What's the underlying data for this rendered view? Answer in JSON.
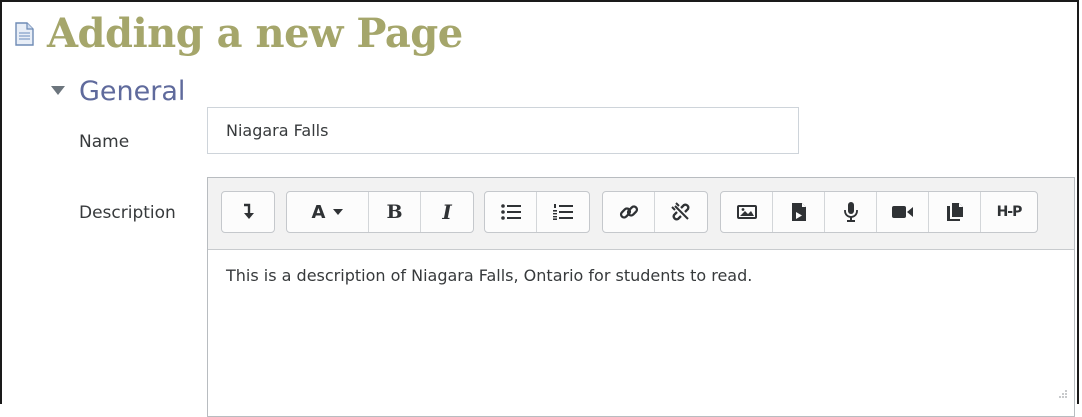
{
  "page": {
    "title": "Adding a new Page",
    "title_color": "#a5a66b"
  },
  "section": {
    "title": "General",
    "title_color": "#5f6a9c"
  },
  "fields": {
    "name_label": "Name",
    "name_value": "Niagara Falls",
    "description_label": "Description",
    "description_text": "This is a description of Niagara Falls, Ontario for students to read."
  },
  "toolbar": {
    "groups": [
      [
        {
          "icon": "collapse-icon"
        }
      ],
      [
        {
          "icon": "font-color-icon",
          "label": "A"
        },
        {
          "icon": "bold-icon",
          "label": "B"
        },
        {
          "icon": "italic-icon",
          "label": "I"
        }
      ],
      [
        {
          "icon": "unordered-list-icon"
        },
        {
          "icon": "ordered-list-icon"
        }
      ],
      [
        {
          "icon": "link-icon"
        },
        {
          "icon": "unlink-icon"
        }
      ],
      [
        {
          "icon": "image-icon"
        },
        {
          "icon": "media-icon"
        },
        {
          "icon": "microphone-icon"
        },
        {
          "icon": "video-icon"
        },
        {
          "icon": "manage-files-icon"
        },
        {
          "icon": "h5p-icon",
          "label": "H-P"
        }
      ]
    ]
  }
}
